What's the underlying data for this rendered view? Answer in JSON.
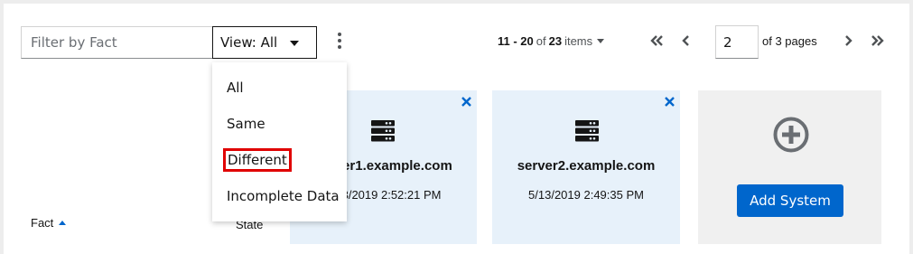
{
  "toolbar": {
    "filter_placeholder": "Filter by Fact",
    "view_select_label": "View: All",
    "kebab_icon": "kebab-icon"
  },
  "view_menu": {
    "items": [
      "All",
      "Same",
      "Different",
      "Incomplete Data"
    ],
    "highlighted": "Different"
  },
  "pagination": {
    "range": "11 - 20",
    "of_label": "of",
    "total": "23",
    "items_label": "items",
    "current_page": "2",
    "of_pages": "of 3 pages"
  },
  "table": {
    "fact_header": "Fact",
    "state_header": "State"
  },
  "systems": [
    {
      "name": "server1.example.com",
      "timestamp": "5/13/2019 2:52:21 PM",
      "icon": "server-icon"
    },
    {
      "name": "server2.example.com",
      "timestamp": "5/13/2019 2:49:35 PM",
      "icon": "server-icon"
    }
  ],
  "add_system": {
    "label": "Add System",
    "icon": "plus-circle-icon"
  },
  "colors": {
    "accent": "#0066cc",
    "card_bg": "#e7f1fa",
    "add_card_bg": "#f0f0f0",
    "highlight": "#e00000"
  }
}
